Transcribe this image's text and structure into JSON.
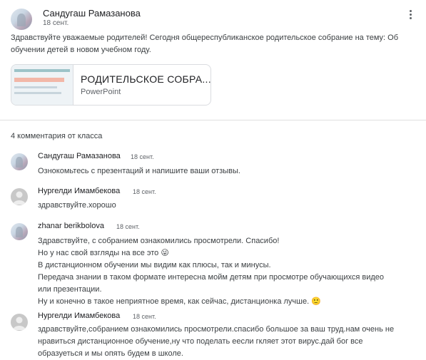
{
  "post": {
    "author": "Сандугаш Рамазанова",
    "date": "18 сент.",
    "text": "Здравствуйте  уважаемые родителей!  Сегодня общереспубликанское родительское собрание на тему: Об обучении детей в новом учебном году.",
    "more_icon": "more-vert-icon",
    "attachment": {
      "title": "РОДИТЕЛЬСКОЕ СОБРА...",
      "type": "PowerPoint"
    }
  },
  "comments_header": "4 комментария от класса",
  "comments": [
    {
      "author": "Сандугаш Рамазанова",
      "date": "18 сент.",
      "lines": [
        "Ознокомьтесь с презентаций  и  напишите ваши отзывы."
      ]
    },
    {
      "author": "Нургелди Имамбекова",
      "date": "18 сент.",
      "lines": [
        "здравствуйте.хорошо"
      ]
    },
    {
      "author": "zhanar berikbolova",
      "date": "18 сент.",
      "lines": [
        "Здравствуйте, с собранием ознакомились просмотрели. Спасибо!",
        "Но у нас свой взгляды на все это 😜",
        "В дистанционном обучении мы видим как плюсы, так и минусы.",
        "Передача знании в таком формате интересна мойм детям при просмотре обучающихся видео",
        "или презентации.",
        "Ну и конечно в такое неприятное время, как сейчас, дистанционка лучше. 🙂"
      ]
    },
    {
      "author": "Нургелди Имамбекова",
      "date": "18 сент.",
      "lines": [
        "здравствуйте,собранием ознакомились просмотрели.спасибо большое за ваш труд.нам очень не",
        "нравиться дистанционное обучение,ну что поделать еесли гкляет этот вирус.дай бог все",
        "образуеться и мы опять будем в школе."
      ]
    }
  ]
}
